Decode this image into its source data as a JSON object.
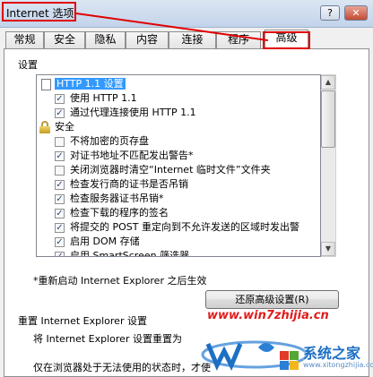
{
  "window": {
    "title": "Internet 选项",
    "help_glyph": "?",
    "close_glyph": "✕"
  },
  "tabs": [
    {
      "label": "常规"
    },
    {
      "label": "安全"
    },
    {
      "label": "隐私"
    },
    {
      "label": "内容"
    },
    {
      "label": "连接"
    },
    {
      "label": "程序"
    },
    {
      "label": "高级",
      "active": true
    }
  ],
  "settings": {
    "group_label": "设置",
    "rows": [
      {
        "type": "page",
        "label": "HTTP 1.1 设置",
        "selected": true
      },
      {
        "type": "checkbox",
        "label": "使用 HTTP 1.1",
        "checked": true
      },
      {
        "type": "checkbox",
        "label": "通过代理连接使用 HTTP 1.1",
        "checked": true
      },
      {
        "type": "lock",
        "label": "安全"
      },
      {
        "type": "checkbox",
        "label": "不将加密的页存盘",
        "checked": false
      },
      {
        "type": "checkbox",
        "label": "对证书地址不匹配发出警告*",
        "checked": true
      },
      {
        "type": "checkbox",
        "label": "关闭浏览器时清空“Internet 临时文件”文件夹",
        "checked": false
      },
      {
        "type": "checkbox",
        "label": "检查发行商的证书是否吊销",
        "checked": true
      },
      {
        "type": "checkbox",
        "label": "检查服务器证书吊销*",
        "checked": true
      },
      {
        "type": "checkbox",
        "label": "检查下载的程序的签名",
        "checked": true
      },
      {
        "type": "checkbox",
        "label": "将提交的 POST 重定向到不允许发送的区域时发出警",
        "checked": true
      },
      {
        "type": "checkbox",
        "label": "启用 DOM 存储",
        "checked": true
      },
      {
        "type": "checkbox",
        "label": "启用 SmartScreen 筛选器",
        "checked": true
      }
    ]
  },
  "restart_note": "*重新启动 Internet Explorer 之后生效",
  "restore_button": "还原高级设置(R)",
  "reset": {
    "group_label": "重置 Internet Explorer 设置",
    "description": "将 Internet Explorer 设置重置为",
    "broken_note": "仅在浏览器处于无法使用的状态时，才使"
  },
  "watermark": {
    "url": "www.win7zhijia.cn",
    "brand": "系统之家",
    "sub": "www.xitongzhijia.com"
  },
  "colors": {
    "annotation": "#e00000",
    "selection": "#3399ff"
  }
}
